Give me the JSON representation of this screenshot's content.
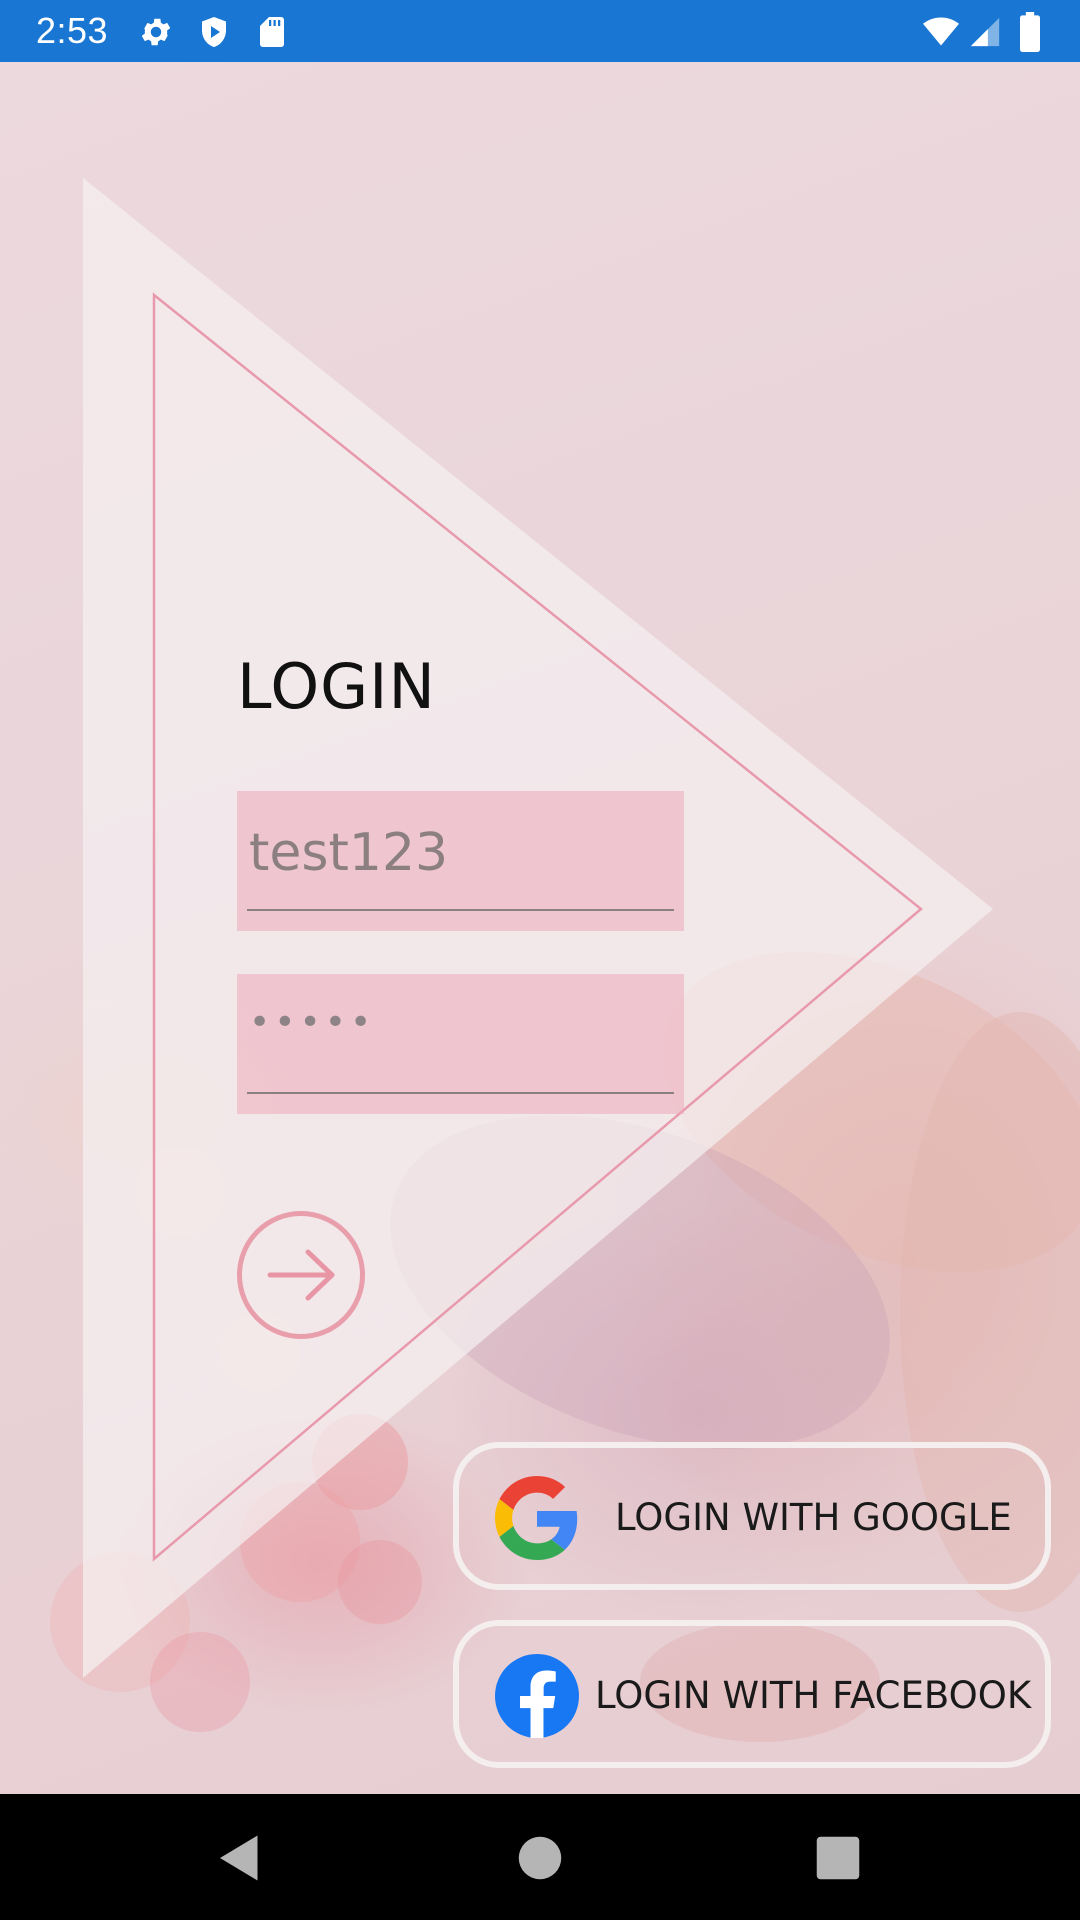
{
  "status_bar": {
    "time": "2:53",
    "icons": [
      "settings-icon",
      "shield-icon",
      "sd-card-icon",
      "wifi-icon",
      "signal-icon",
      "battery-icon"
    ],
    "background_color": "#1976d2"
  },
  "login": {
    "title": "LOGIN",
    "username_value": "test123",
    "password_mask": "•••••",
    "accent_color": "#e896a5"
  },
  "social": {
    "google_label": "LOGIN WITH GOOGLE",
    "facebook_label": "LOGIN WITH FACEBOOK"
  },
  "nav_bar": {
    "buttons": [
      "back-icon",
      "home-icon",
      "recents-icon"
    ]
  }
}
